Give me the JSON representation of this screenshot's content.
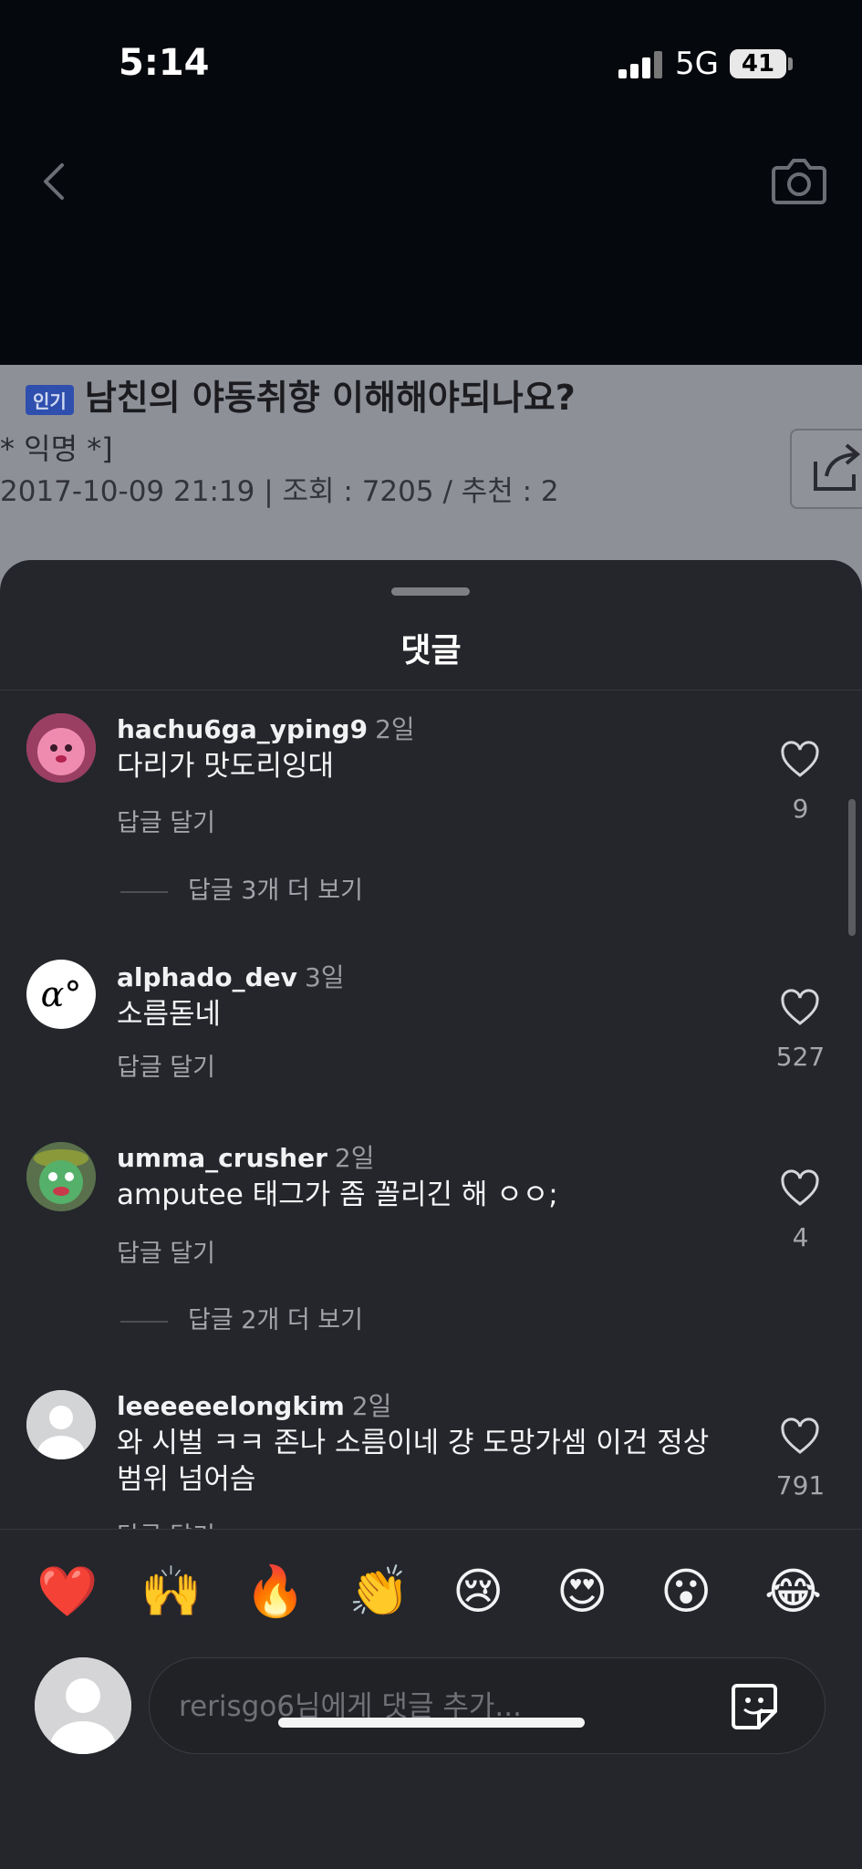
{
  "status_bar": {
    "time": "5:14",
    "network": "5G",
    "battery": "41"
  },
  "post": {
    "tag": "인기",
    "title": "남친의 야동취향 이해해야되나요?",
    "author": "* 익명 *]",
    "meta": "2017-10-09 21:19 | 조회 : 7205 / 추천 : 2"
  },
  "sheet": {
    "title": "댓글"
  },
  "comments": [
    {
      "username": "hachu6ga_yping9",
      "ago": "2일",
      "text": "다리가 맛도리잉대",
      "reply": "답글 달기",
      "likes": "9",
      "more": "답글 3개 더 보기"
    },
    {
      "username": "alphado_dev",
      "ago": "3일",
      "text": "소름돋네",
      "reply": "답글 달기",
      "likes": "527",
      "avatar_text": "α°"
    },
    {
      "username": "umma_crusher",
      "ago": "2일",
      "text": "amputee 태그가 좀 꼴리긴 해 ㅇㅇ;",
      "reply": "답글 달기",
      "likes": "4",
      "more": "답글 2개 더 보기"
    },
    {
      "username": "leeeeeelongkim",
      "ago": "2일",
      "text": "와 시벌 ㅋㅋ 존나 소름이네 걍 도망가셈 이건 정상 범위 넘어슴",
      "reply": "답글 달기",
      "likes": "791"
    }
  ],
  "emojis": [
    "❤️",
    "🙌",
    "🔥",
    "👏",
    "😢",
    "😍",
    "😮",
    "😂"
  ],
  "composer": {
    "placeholder": "rerisgo6님에게 댓글 추가..."
  },
  "colors": {
    "sheet_bg": "#24262b",
    "page_bg": "#05080d",
    "post_overlay": "#8d9097"
  }
}
